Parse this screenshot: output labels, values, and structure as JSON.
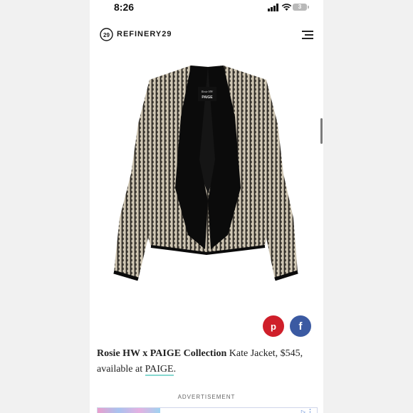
{
  "status_bar": {
    "time": "8:26",
    "battery_level": "3"
  },
  "header": {
    "brand": "REFINERY29",
    "logo_icon": "refinery29-logo-icon",
    "menu_icon": "hamburger-menu-icon"
  },
  "product_image": {
    "label_line1": "Rosie HW",
    "label_line2": "PAIGE"
  },
  "share": {
    "pinterest_icon": "pinterest-icon",
    "pinterest_glyph": "p",
    "pinterest_color": "#cf1f2a",
    "facebook_icon": "facebook-icon",
    "facebook_glyph": "f",
    "facebook_color": "#3b5aa2"
  },
  "caption": {
    "collection": "Rosie HW x PAIGE Collection",
    "product_text": " Kate Jacket, $545, available at ",
    "retailer_link": "PAIGE",
    "end_punctuation": ".",
    "link_underline_color": "#86d8d0"
  },
  "advertisement": {
    "label": "ADVERTISEMENT"
  }
}
